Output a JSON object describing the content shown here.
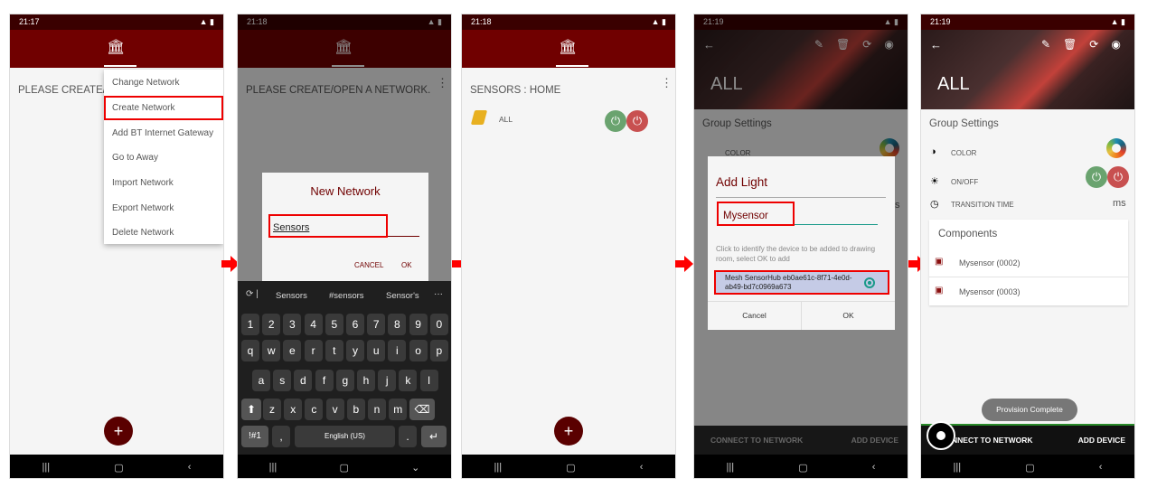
{
  "screens": [
    {
      "time": "21:17",
      "message": "PLEASE CREATE/OPEN A NETWORK.",
      "menu": [
        "Change Network",
        "Create Network",
        "Add BT Internet Gateway",
        "Go to Away",
        "Import Network",
        "Export Network",
        "Delete Network"
      ],
      "fab": "+"
    },
    {
      "time": "21:18",
      "message": "PLEASE CREATE/OPEN A NETWORK.",
      "dialog": {
        "title": "New Network",
        "value": "Sensors",
        "cancel": "CANCEL",
        "ok": "OK"
      },
      "keyboard": {
        "suggestions": [
          "Sensors",
          "#sensors",
          "Sensor's"
        ],
        "more": "···",
        "rows": [
          [
            "1",
            "2",
            "3",
            "4",
            "5",
            "6",
            "7",
            "8",
            "9",
            "0"
          ],
          [
            "q",
            "w",
            "e",
            "r",
            "t",
            "y",
            "u",
            "i",
            "o",
            "p"
          ],
          [
            "a",
            "s",
            "d",
            "f",
            "g",
            "h",
            "j",
            "k",
            "l"
          ],
          [
            "z",
            "x",
            "c",
            "v",
            "b",
            "n",
            "m"
          ]
        ],
        "symbols": "!#1",
        "comma": ",",
        "space": "English (US)",
        "period": "."
      }
    },
    {
      "time": "21:18",
      "title": "SENSORS : HOME",
      "group": "ALL",
      "fab": "+"
    },
    {
      "time": "21:19",
      "header": "ALL",
      "group_settings": "Group Settings",
      "color": "COLOR",
      "dialog": {
        "title": "Add Light",
        "value": "Mysensor",
        "hint": "Click to identify the device to be added to drawing room, select OK to add",
        "device": "Mesh SensorHub eb0ae61c-8f71-4e0d-ab49-bd7c0969a673",
        "cancel": "Cancel",
        "ok": "OK"
      },
      "connect": "CONNECT TO NETWORK",
      "add_device": "ADD DEVICE",
      "ms": "s"
    },
    {
      "time": "21:19",
      "header": "ALL",
      "group_settings": "Group Settings",
      "color": "COLOR",
      "onoff": "ON/OFF",
      "transition": "TRANSITION TIME",
      "ms": "ms",
      "components_title": "Components",
      "components": [
        "Mysensor (0002)",
        "Mysensor (0003)"
      ],
      "toast": "Provision Complete",
      "connect": "NNECT TO NETWORK",
      "add_device": "ADD DEVICE"
    }
  ],
  "colors": {
    "primary": "#700000",
    "status": "#3a0000",
    "highlight": "#ee0000",
    "on": "#6aa36f",
    "off": "#c85050"
  }
}
